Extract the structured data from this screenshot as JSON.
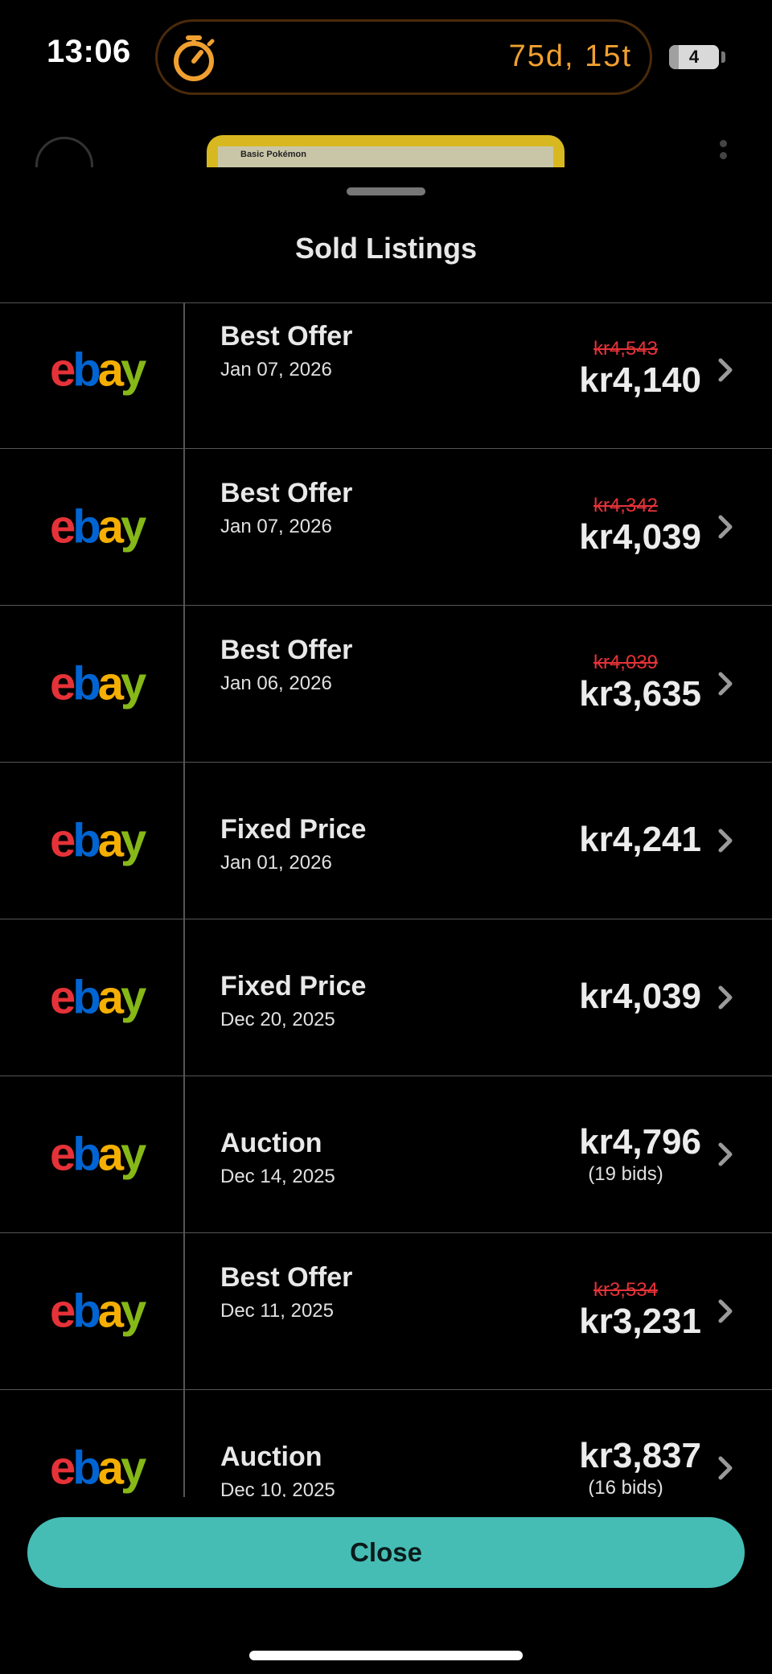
{
  "status_bar": {
    "time": "13:06",
    "timer_text": "75d, 15t",
    "battery_level": "4"
  },
  "background": {
    "card_label": "Basic Pokémon"
  },
  "sheet": {
    "title": "Sold Listings",
    "close_label": "Close"
  },
  "colors": {
    "accent_teal": "#45bdb5",
    "timer_orange": "#f0a030",
    "strike_red": "#e53238",
    "ebay_e": "#e53238",
    "ebay_b": "#0064d2",
    "ebay_a": "#f5af02",
    "ebay_y": "#86b817"
  },
  "listings": [
    {
      "marketplace": "ebay",
      "type": "Best Offer",
      "date": "Jan 07, 2026",
      "original_price": "kr4,543",
      "price": "kr4,140",
      "bids": ""
    },
    {
      "marketplace": "ebay",
      "type": "Best Offer",
      "date": "Jan 07, 2026",
      "original_price": "kr4,342",
      "price": "kr4,039",
      "bids": ""
    },
    {
      "marketplace": "ebay",
      "type": "Best Offer",
      "date": "Jan 06, 2026",
      "original_price": "kr4,039",
      "price": "kr3,635",
      "bids": ""
    },
    {
      "marketplace": "ebay",
      "type": "Fixed Price",
      "date": "Jan 01, 2026",
      "original_price": "",
      "price": "kr4,241",
      "bids": ""
    },
    {
      "marketplace": "ebay",
      "type": "Fixed Price",
      "date": "Dec 20, 2025",
      "original_price": "",
      "price": "kr4,039",
      "bids": ""
    },
    {
      "marketplace": "ebay",
      "type": "Auction",
      "date": "Dec 14, 2025",
      "original_price": "",
      "price": "kr4,796",
      "bids": "(19 bids)"
    },
    {
      "marketplace": "ebay",
      "type": "Best Offer",
      "date": "Dec 11, 2025",
      "original_price": "kr3,534",
      "price": "kr3,231",
      "bids": ""
    },
    {
      "marketplace": "ebay",
      "type": "Auction",
      "date": "Dec 10, 2025",
      "original_price": "",
      "price": "kr3,837",
      "bids": "(16 bids)"
    }
  ]
}
